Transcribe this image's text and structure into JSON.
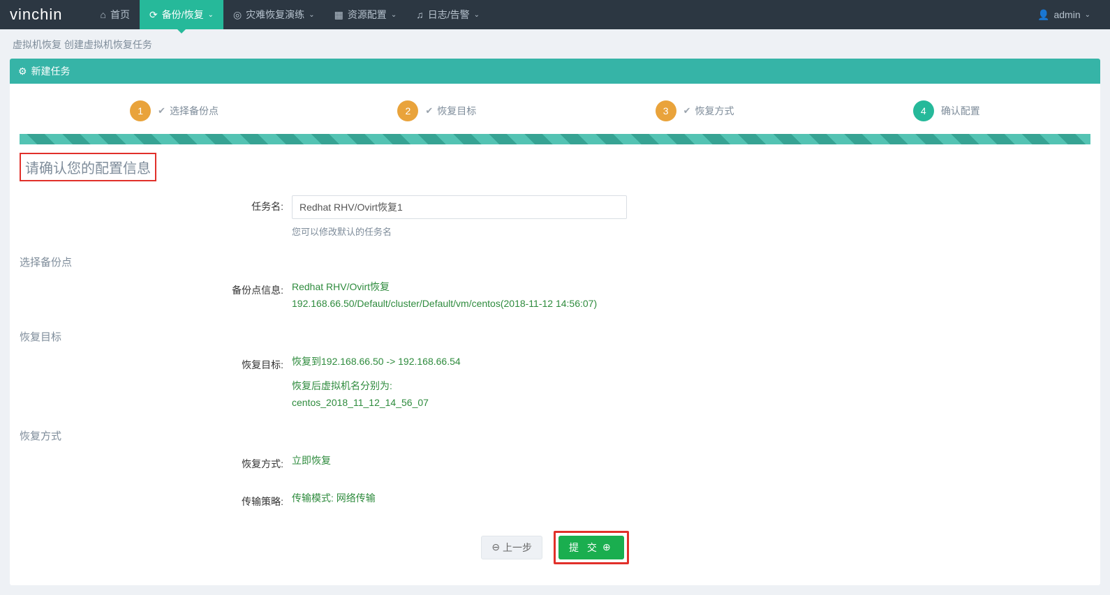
{
  "brand": "vinchin",
  "nav": {
    "home": "首页",
    "backup": "备份/恢复",
    "dr": "灾难恢复演练",
    "res": "资源配置",
    "log": "日志/告警"
  },
  "user": {
    "name": "admin"
  },
  "breadcrumb": "虚拟机恢复 创建虚拟机恢复任务",
  "panel": {
    "title": "新建任务"
  },
  "wizard": {
    "s1": "选择备份点",
    "s2": "恢复目标",
    "s3": "恢复方式",
    "s4": "确认配置"
  },
  "confirm": {
    "heading": "请确认您的配置信息",
    "jobname_label": "任务名:",
    "jobname_value": "Redhat RHV/Ovirt恢复1",
    "jobname_hint": "您可以修改默认的任务名",
    "section_point": "选择备份点",
    "point_info_label": "备份点信息:",
    "point_line1": "Redhat RHV/Ovirt恢复",
    "point_line2": "192.168.66.50/Default/cluster/Default/vm/centos(2018-11-12 14:56:07)",
    "section_target": "恢复目标",
    "target_label": "恢复目标:",
    "target_line1": "恢复到192.168.66.50 -> 192.168.66.54",
    "target_line2": "恢复后虚拟机名分别为:",
    "target_line3": "centos_2018_11_12_14_56_07",
    "section_method": "恢复方式",
    "method_label": "恢复方式:",
    "method_value": "立即恢复",
    "transfer_label": "传输策略:",
    "transfer_value": "传输模式: 网络传输"
  },
  "buttons": {
    "prev": "上一步",
    "submit": "提 交"
  }
}
